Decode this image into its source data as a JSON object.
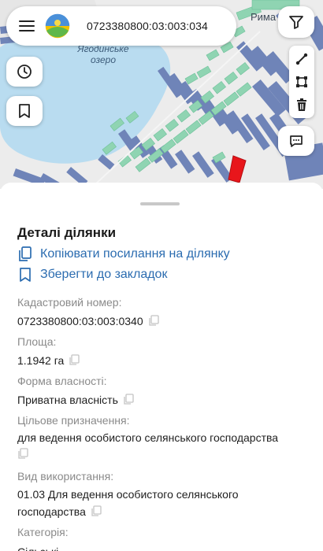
{
  "header": {
    "search_value": "0723380800:03:003:034"
  },
  "map": {
    "lake_label_line1": "Ягодинське",
    "lake_label_line2": "озеро",
    "town_label": "Рима"
  },
  "icons": {
    "menu": "hamburger-icon",
    "logo": "app-logo",
    "filter": "filter-icon",
    "history": "clock-icon",
    "bookmark": "bookmark-icon",
    "measure": "ruler-line-icon",
    "polygon": "polygon-icon",
    "delete": "trash-icon",
    "comment": "comment-icon",
    "copy": "copy-icon"
  },
  "colors": {
    "link": "#2b6cb0",
    "selected_parcel": "#e8161b",
    "parcel_green": "#8fd4b2",
    "parcel_blue": "#6f84b8",
    "lake": "#b9dcf0"
  },
  "sheet": {
    "title": "Деталі ділянки",
    "copy_link_label": "Копіювати посилання на ділянку",
    "save_bookmark_label": "Зберегти до закладок",
    "fields": [
      {
        "label": "Кадастровий номер:",
        "value": "0723380800:03:003:0340"
      },
      {
        "label": "Площа:",
        "value": "1.1942 га"
      },
      {
        "label": "Форма власності:",
        "value": "Приватна власність"
      },
      {
        "label": "Цільове призначення:",
        "value": "для ведення особистого селянського господарства"
      },
      {
        "label": "Вид використання:",
        "value_line1": "01.03 Для ведення особистого селянського",
        "value_line2": "господарства"
      },
      {
        "label": "Категорія:",
        "value": "Сільські..."
      }
    ]
  }
}
